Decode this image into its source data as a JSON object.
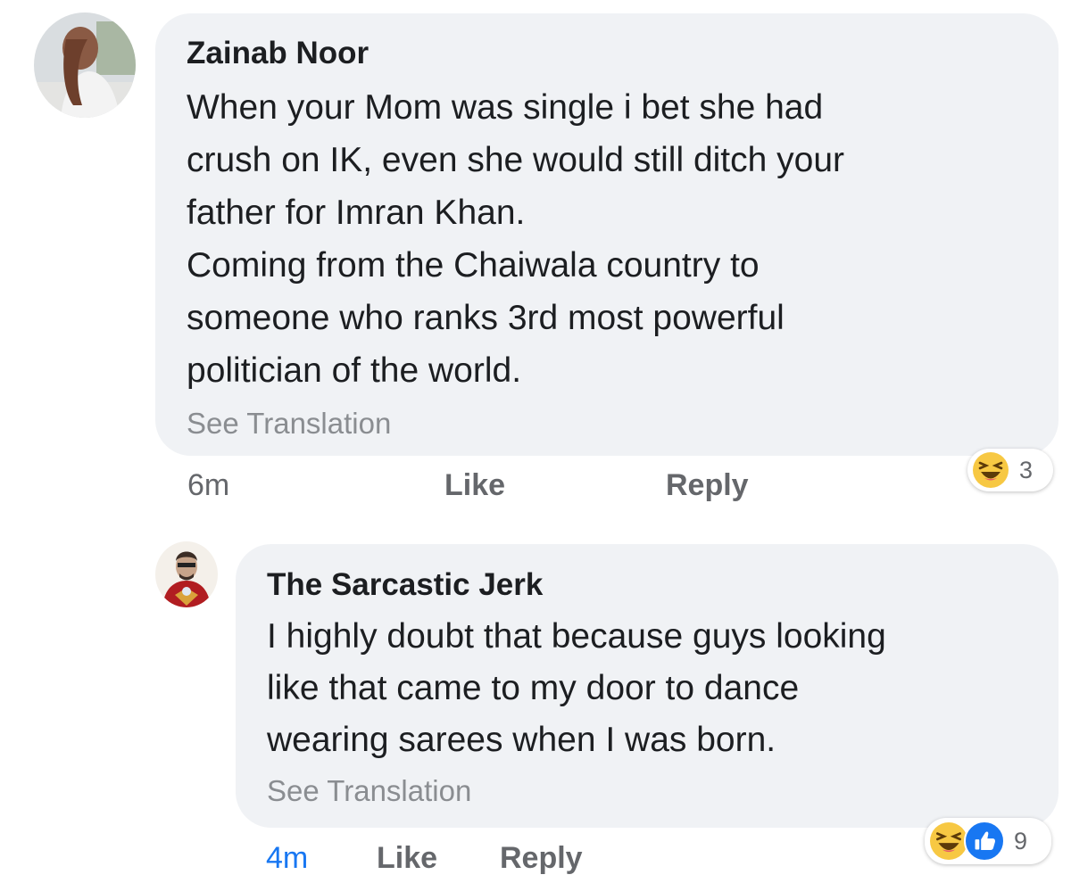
{
  "comments": [
    {
      "author": "Zainab Noor",
      "text": "When your Mom was single i bet she had\ncrush on IK, even she would still ditch your\nfather for Imran Khan.\nComing from the Chaiwala country to\nsomeone who ranks 3rd most powerful\npolitician of the world.",
      "translation_label": "See Translation",
      "time": "6m",
      "like_label": "Like",
      "reply_label": "Reply",
      "reactions": {
        "icons": [
          "haha-icon"
        ],
        "count": "3"
      }
    },
    {
      "author": "The Sarcastic Jerk",
      "text": "I highly doubt that because guys looking\nlike that came to my door to dance\nwearing sarees when I was born.",
      "translation_label": "See Translation",
      "time": "4m",
      "like_label": "Like",
      "reply_label": "Reply",
      "reactions": {
        "icons": [
          "haha-icon",
          "like-icon"
        ],
        "count": "9"
      }
    }
  ],
  "colors": {
    "bubble": "#f0f2f5",
    "meta_text": "#65676b",
    "time_blue": "#1877f2",
    "haha_yellow": "#f7c843",
    "like_blue": "#1877f2"
  }
}
